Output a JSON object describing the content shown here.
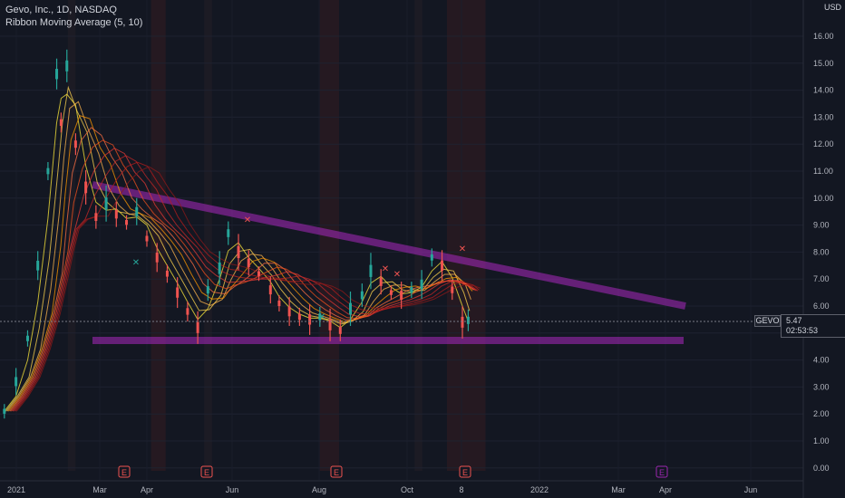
{
  "legend": {
    "symbol_line": "Gevo, Inc., 1D, NASDAQ",
    "indicator_line": "Ribbon Moving Average (5, 10)"
  },
  "currency": "USD",
  "price_tag": {
    "symbol": "GEVO",
    "value": "5.47",
    "countdown": "02:53:53"
  },
  "chart_data": {
    "type": "line",
    "title": "",
    "xlabel": "",
    "ylabel": "",
    "y_ticks": [
      "16.00",
      "15.00",
      "14.00",
      "13.00",
      "12.00",
      "11.00",
      "10.00",
      "9.00",
      "8.00",
      "7.00",
      "6.00",
      "5.00",
      "4.00",
      "3.00",
      "2.00",
      "1.00",
      "0.00"
    ],
    "ylim": [
      0,
      16.5
    ],
    "x_ticks": [
      "2021",
      "Mar",
      "Apr",
      "Jun",
      "Aug",
      "Oct",
      "8",
      "2022",
      "Mar",
      "Apr",
      "Jun"
    ],
    "x_range": [
      "2021-01-01",
      "2022-06-15"
    ],
    "grid": true,
    "earnings_markers": [
      "E",
      "E",
      "E",
      "E",
      "E"
    ],
    "series": [
      {
        "values": [
          [
            "2021-01-04",
            2.1
          ],
          [
            "2021-01-12",
            3.2
          ],
          [
            "2021-01-20",
            4.8
          ],
          [
            "2021-01-27",
            7.5
          ],
          [
            "2021-02-03",
            11.0
          ],
          [
            "2021-02-09",
            14.6
          ],
          [
            "2021-02-12",
            12.8
          ],
          [
            "2021-02-16",
            14.9
          ],
          [
            "2021-02-22",
            12.0
          ],
          [
            "2021-03-01",
            10.4
          ],
          [
            "2021-03-08",
            9.3
          ],
          [
            "2021-03-15",
            9.8
          ],
          [
            "2021-03-22",
            9.4
          ],
          [
            "2021-03-29",
            9.1
          ],
          [
            "2021-04-05",
            9.5
          ],
          [
            "2021-04-12",
            8.5
          ],
          [
            "2021-04-19",
            7.8
          ],
          [
            "2021-04-26",
            7.2
          ],
          [
            "2021-05-03",
            6.5
          ],
          [
            "2021-05-10",
            5.8
          ],
          [
            "2021-05-17",
            5.2
          ],
          [
            "2021-05-24",
            6.6
          ],
          [
            "2021-06-01",
            7.4
          ],
          [
            "2021-06-07",
            8.7
          ],
          [
            "2021-06-14",
            8.0
          ],
          [
            "2021-06-21",
            7.6
          ],
          [
            "2021-06-28",
            7.2
          ],
          [
            "2021-07-06",
            6.6
          ],
          [
            "2021-07-12",
            6.1
          ],
          [
            "2021-07-19",
            5.8
          ],
          [
            "2021-07-26",
            5.6
          ],
          [
            "2021-08-02",
            5.5
          ],
          [
            "2021-08-09",
            5.6
          ],
          [
            "2021-08-16",
            5.3
          ],
          [
            "2021-08-23",
            5.1
          ],
          [
            "2021-08-30",
            5.9
          ],
          [
            "2021-09-07",
            6.4
          ],
          [
            "2021-09-13",
            7.3
          ],
          [
            "2021-09-20",
            6.9
          ],
          [
            "2021-09-27",
            6.5
          ],
          [
            "2021-10-04",
            6.4
          ],
          [
            "2021-10-11",
            6.6
          ],
          [
            "2021-10-18",
            6.8
          ],
          [
            "2021-10-25",
            7.8
          ],
          [
            "2021-11-01",
            7.5
          ],
          [
            "2021-11-08",
            6.6
          ],
          [
            "2021-11-15",
            5.4
          ],
          [
            "2021-11-19",
            5.47
          ]
        ]
      }
    ],
    "annotations": {
      "trendline_upper": [
        [
          "2021-03-01",
          10.5
        ],
        [
          "2022-05-01",
          6.0
        ]
      ],
      "support_line": [
        [
          "2021-03-01",
          4.7
        ],
        [
          "2022-05-01",
          4.7
        ]
      ]
    }
  }
}
